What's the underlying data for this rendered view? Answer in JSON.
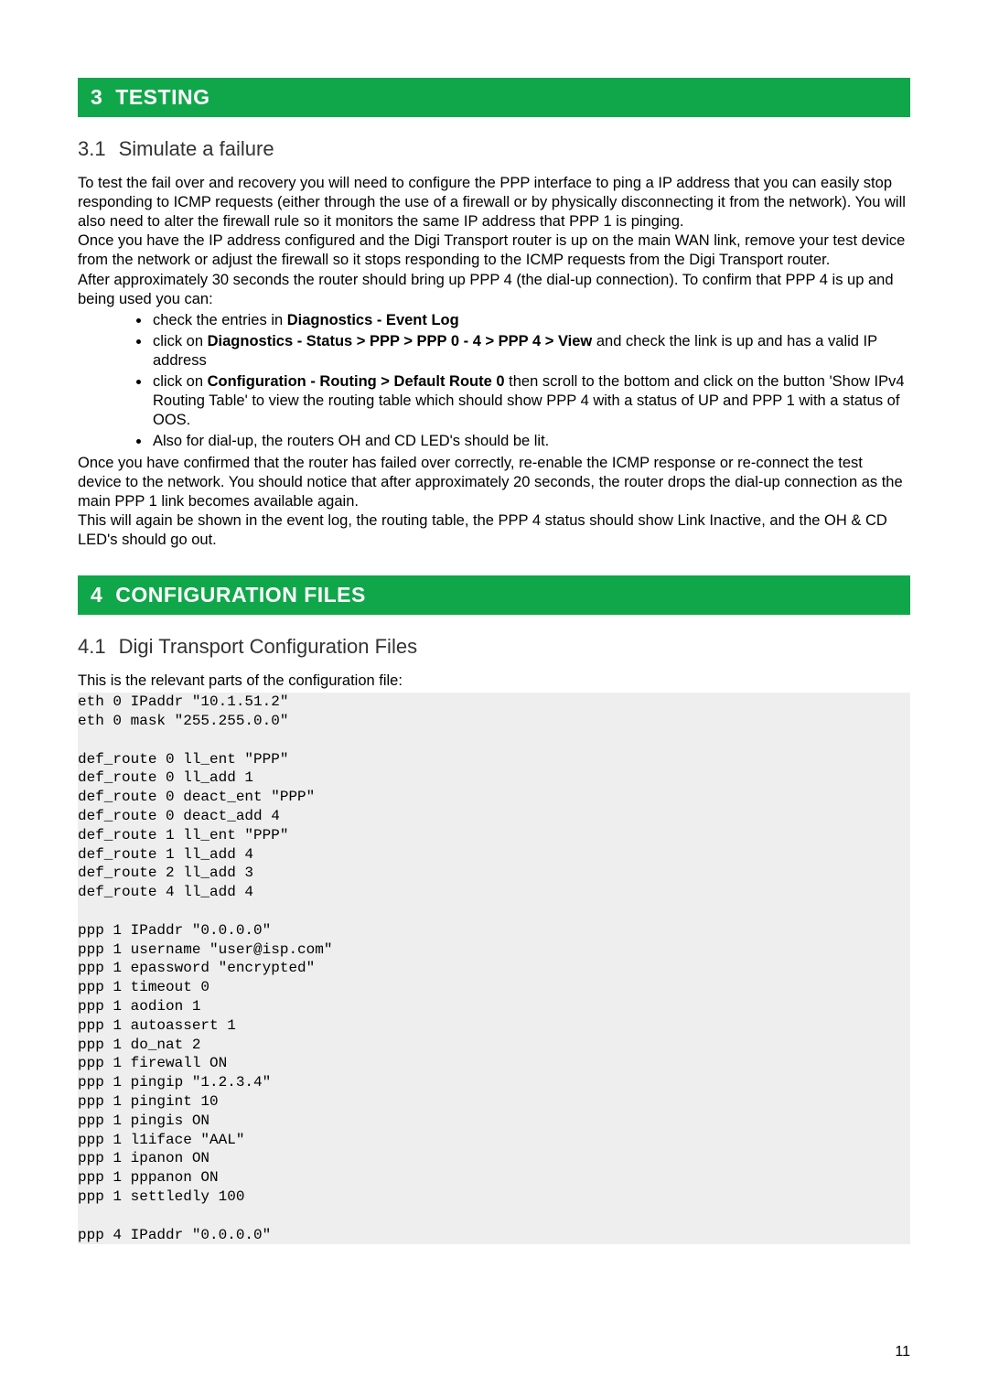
{
  "section3": {
    "number": "3",
    "title": "TESTING",
    "sub": {
      "number": "3.1",
      "title": "Simulate a failure",
      "para1": "To test the fail over and recovery you will need to configure the PPP interface to ping a IP address that you can easily stop responding to ICMP requests (either through the use of a firewall or by physically disconnecting it from the network).  You will also need to alter the firewall rule so it monitors the same IP address that PPP 1 is pinging.",
      "para2": "Once you have the IP address configured and the Digi Transport router is up on the main WAN link, remove your test device from the network or adjust the firewall so it stops responding to the ICMP requests from the Digi Transport router.",
      "para3": "After approximately 30 seconds the router should bring up PPP 4 (the dial-up connection).  To confirm that PPP 4 is up and being used you can:",
      "bullet1_pre": "check the entries in ",
      "bullet1_bold": "Diagnostics - Event Log",
      "bullet2_pre": "click on ",
      "bullet2_bold": "Diagnostics - Status > PPP > PPP 0 - 4 > PPP 4 > View",
      "bullet2_post": " and check the link is up and has a valid IP address",
      "bullet3_pre": "click on ",
      "bullet3_bold": "Configuration - Routing > Default Route 0",
      "bullet3_post": " then scroll to the bottom and click on the button 'Show IPv4 Routing Table' to view the routing table which should show PPP 4 with a status of UP and PPP 1 with a status of OOS.",
      "bullet4": "Also for dial-up, the routers OH and CD LED's should be lit.",
      "para4": "Once you have confirmed that the router has failed over correctly, re-enable the ICMP response or re-connect the test device to the network.  You should notice that after approximately 20 seconds, the router drops the dial-up connection as the main PPP 1 link becomes available again.",
      "para5": "This will again be shown in the event log, the routing table, the PPP 4 status should show Link Inactive, and the OH & CD LED's should go out."
    }
  },
  "section4": {
    "number": "4",
    "title": "CONFIGURATION FILES",
    "sub": {
      "number": "4.1",
      "title": "Digi Transport Configuration Files",
      "intro": "This is the relevant parts of the configuration file:",
      "code": "eth 0 IPaddr \"10.1.51.2\"\neth 0 mask \"255.255.0.0\"\n\ndef_route 0 ll_ent \"PPP\"\ndef_route 0 ll_add 1\ndef_route 0 deact_ent \"PPP\"\ndef_route 0 deact_add 4\ndef_route 1 ll_ent \"PPP\"\ndef_route 1 ll_add 4\ndef_route 2 ll_add 3\ndef_route 4 ll_add 4\n\nppp 1 IPaddr \"0.0.0.0\"\nppp 1 username \"user@isp.com\"\nppp 1 epassword \"encrypted\"\nppp 1 timeout 0\nppp 1 aodion 1\nppp 1 autoassert 1\nppp 1 do_nat 2\nppp 1 firewall ON\nppp 1 pingip \"1.2.3.4\"\nppp 1 pingint 10\nppp 1 pingis ON\nppp 1 l1iface \"AAL\"\nppp 1 ipanon ON\nppp 1 pppanon ON\nppp 1 settledly 100\n\nppp 4 IPaddr \"0.0.0.0\""
    }
  },
  "page_number": "11"
}
